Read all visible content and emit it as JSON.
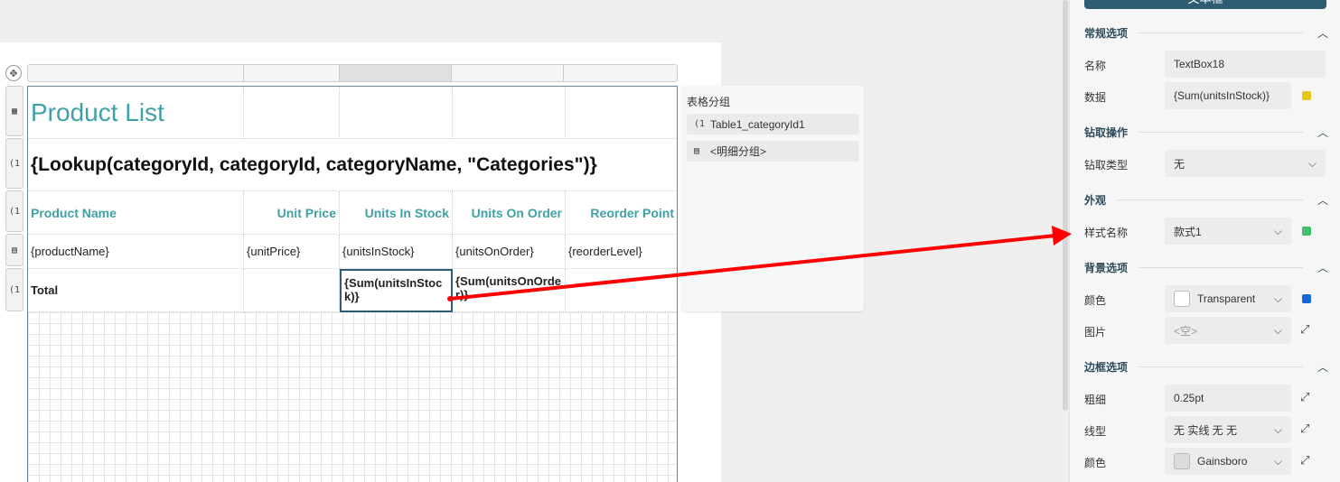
{
  "toolbar": {
    "top_button": "文本框"
  },
  "canvas": {
    "row_icons": [
      "▦",
      "(1",
      "(1",
      "▤",
      "(1"
    ],
    "move_icon": "✥"
  },
  "table": {
    "title": "Product List",
    "lookup": "{Lookup(categoryId, categoryId, categoryName, \"Categories\")}",
    "headers": [
      "Product Name",
      "Unit Price",
      "Units In Stock",
      "Units On Order",
      "Reorder Point"
    ],
    "detail": [
      "{productName}",
      "{unitPrice}",
      "{unitsInStock}",
      "{unitsOnOrder}",
      "{reorderLevel}"
    ],
    "total_label": "Total",
    "total_stock": "{Sum(unitsInStock)}",
    "total_order": "{Sum(unitsOnOrder)}"
  },
  "groups": {
    "title": "表格分组",
    "items": [
      {
        "icon": "(1",
        "label": "Table1_categoryId1"
      },
      {
        "icon": "▤",
        "label": "<明细分组>"
      }
    ]
  },
  "props": {
    "general": {
      "title": "常规选项",
      "name_label": "名称",
      "name_value": "TextBox18",
      "data_label": "数据",
      "data_value": "{Sum(unitsInStock)}"
    },
    "drill": {
      "title": "钻取操作",
      "type_label": "钻取类型",
      "type_value": "无"
    },
    "appearance": {
      "title": "外观",
      "style_label": "样式名称",
      "style_value": "款式1"
    },
    "background": {
      "title": "背景选项",
      "color_label": "颜色",
      "color_value": "Transparent",
      "image_label": "图片",
      "image_value": "<空>"
    },
    "border": {
      "title": "边框选项",
      "width_label": "粗细",
      "width_value": "0.25pt",
      "style_label": "线型",
      "style_value": "无 实线 无 无",
      "color_label": "颜色",
      "color_value": "Gainsboro"
    }
  },
  "colors": {
    "accent": "#2e5d73",
    "title_teal": "#3fa1a5",
    "data_dot": "#e6c619",
    "style_dot": "#3cc06a",
    "bg_dot": "#1668d6",
    "gainsboro": "#dcdcdc",
    "arrow": "#ff0000"
  }
}
